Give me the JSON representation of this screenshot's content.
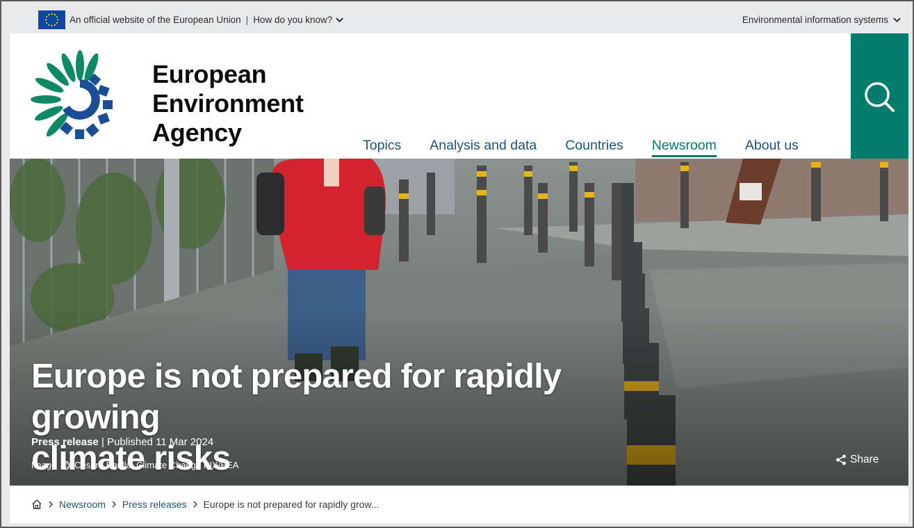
{
  "eu_bar": {
    "official_text": "An official website of the European Union",
    "how_text": "How do you know?",
    "env_systems": "Environmental information systems"
  },
  "logo": {
    "line1": "European",
    "line2": "Environment",
    "line3": "Agency"
  },
  "nav": {
    "items": [
      {
        "label": "Topics"
      },
      {
        "label": "Analysis and data"
      },
      {
        "label": "Countries"
      },
      {
        "label": "Newsroom"
      },
      {
        "label": "About us"
      }
    ],
    "active": "Newsroom"
  },
  "hero": {
    "title_line1": "Europe is not prepared for rapidly growing",
    "title_line2": "climate risks",
    "type": "Press release",
    "published": "Published 11 Mar 2024",
    "credit_label": "Image",
    "credit_text": "Cesare Barillà, Climate Change PIX/EEA",
    "share": "Share"
  },
  "breadcrumb": {
    "items": [
      "Newsroom",
      "Press releases"
    ],
    "current": "Europe is not prepared for rapidly grow..."
  },
  "colors": {
    "brand_green": "#007b6c",
    "nav_blue": "#1b5476",
    "eu_blue": "#0e47a3"
  },
  "icons": [
    "eu-flag-icon",
    "chevron-down-icon",
    "search-icon",
    "copyright-icon",
    "share-icon",
    "home-icon",
    "chevron-right-icon"
  ]
}
